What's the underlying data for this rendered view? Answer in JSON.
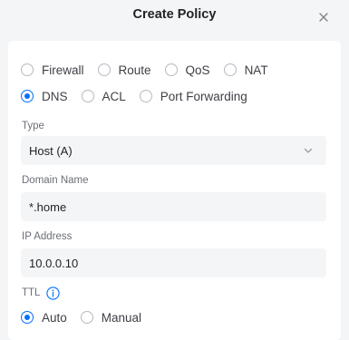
{
  "dialog": {
    "title": "Create Policy"
  },
  "policy_types": {
    "row1": [
      "Firewall",
      "Route",
      "QoS",
      "NAT"
    ],
    "row2": [
      "DNS",
      "ACL",
      "Port Forwarding"
    ],
    "selected": "DNS"
  },
  "form": {
    "type_label": "Type",
    "type_value": "Host (A)",
    "domain_label": "Domain Name",
    "domain_value": "*.home",
    "ip_label": "IP Address",
    "ip_value": "10.0.0.10",
    "ttl_label": "TTL",
    "ttl_options": [
      "Auto",
      "Manual"
    ],
    "ttl_selected": "Auto"
  },
  "colors": {
    "accent": "#006fff",
    "panel_bg": "#ffffff",
    "page_bg": "#f4f5f6"
  },
  "icons": {
    "close": "close-icon",
    "chevron": "chevron-down-icon",
    "info": "info-icon"
  }
}
